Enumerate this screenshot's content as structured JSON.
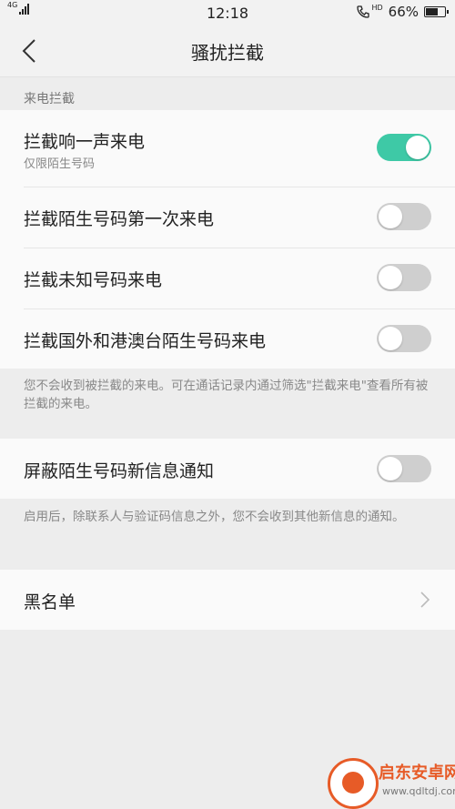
{
  "status_bar": {
    "network": "4G",
    "time": "12:18",
    "hd_label": "HD",
    "battery": "66%",
    "battery_level": 0.66
  },
  "nav": {
    "title": "骚扰拦截"
  },
  "call_section": {
    "header": "来电拦截",
    "items": [
      {
        "label": "拦截响一声来电",
        "sub": "仅限陌生号码",
        "on": true
      },
      {
        "label": "拦截陌生号码第一次来电",
        "on": false
      },
      {
        "label": "拦截未知号码来电",
        "on": false
      },
      {
        "label": "拦截国外和港澳台陌生号码来电",
        "on": false
      }
    ],
    "note": "您不会收到被拦截的来电。可在通话记录内通过筛选\"拦截来电\"查看所有被拦截的来电。"
  },
  "sms_section": {
    "item": {
      "label": "屏蔽陌生号码新信息通知",
      "on": false
    },
    "note": "启用后，除联系人与验证码信息之外，您不会收到其他新信息的通知。"
  },
  "blacklist": {
    "label": "黑名单"
  },
  "watermark": {
    "text": "启东安卓网",
    "url": "www.qdltdj.com"
  },
  "colors": {
    "accent": "#3ec9a6",
    "toggle_off": "#cfcfcf",
    "background": "#ededed",
    "card": "#fafafa"
  }
}
